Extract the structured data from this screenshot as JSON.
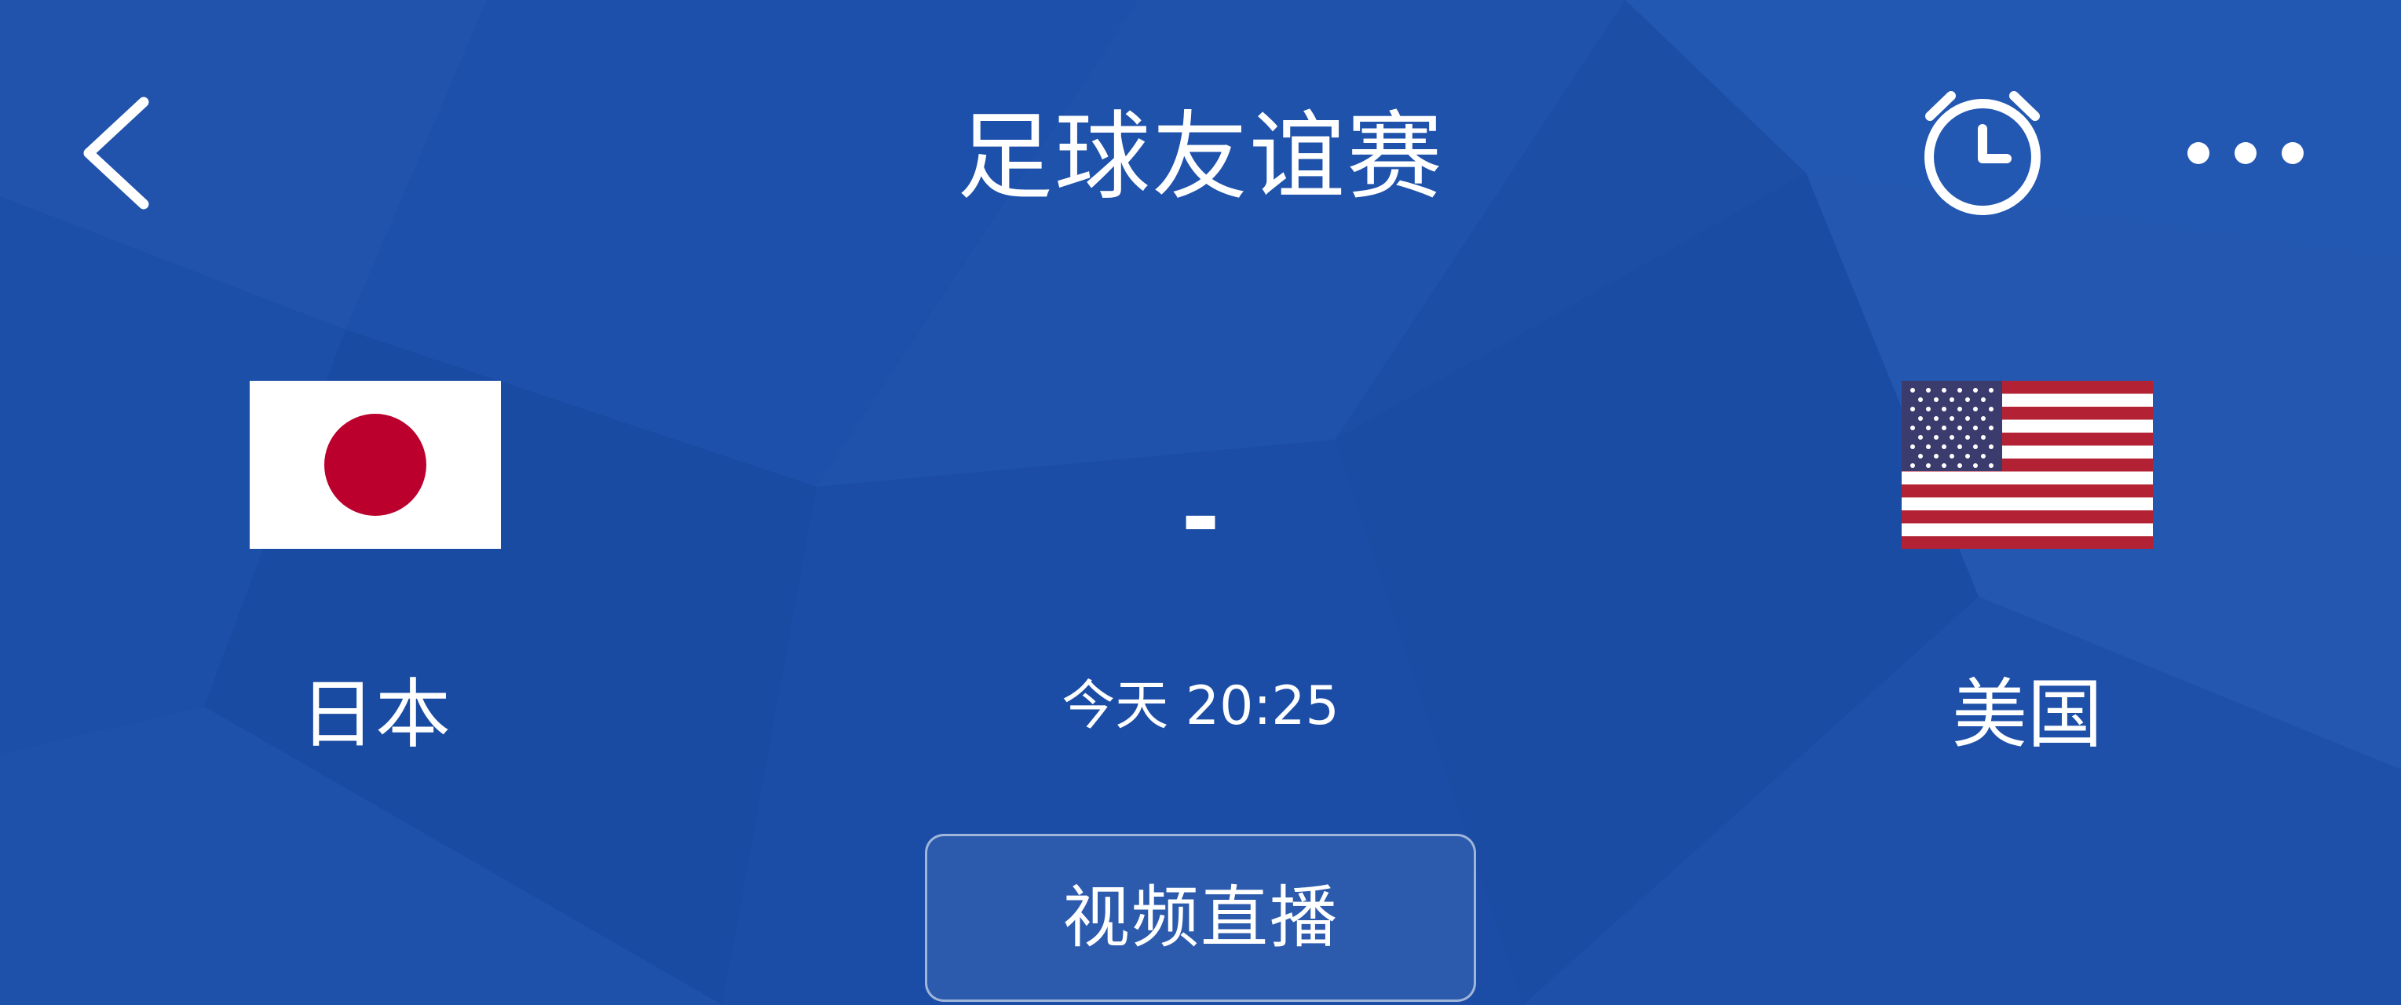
{
  "header": {
    "title": "足球友谊赛",
    "back_icon": "chevron-left-icon",
    "alarm_icon": "alarm-clock-icon",
    "more_icon": "more-horizontal-icon"
  },
  "match": {
    "home_team": {
      "name": "日本",
      "flag": "japan-flag-icon"
    },
    "away_team": {
      "name": "美国",
      "flag": "usa-flag-icon"
    },
    "score_text": "-",
    "time_text": "今天 20:25"
  },
  "actions": {
    "video_button_label": "视频直播"
  },
  "theme": {
    "background": "#1c4ea6",
    "text": "#ffffff",
    "japan_red": "#bc002d",
    "usa_red": "#b22234",
    "usa_blue": "#3c3b6e"
  }
}
